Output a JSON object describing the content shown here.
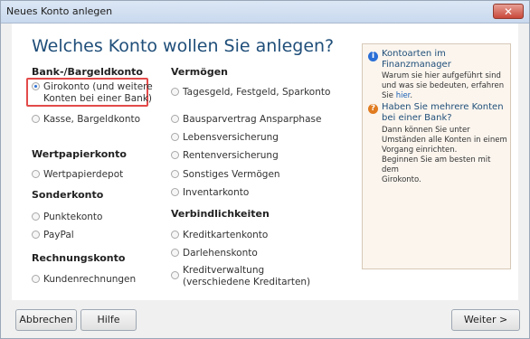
{
  "window": {
    "title": "Neues Konto anlegen",
    "close_symbol": "✕"
  },
  "heading": "Welches Konto wollen Sie anlegen?",
  "columns": {
    "bank_title": "Bank-/Bargeldkonto",
    "girokonto_line1": "Girokonto (und weitere",
    "girokonto_line2": "Konten bei einer Bank)",
    "kasse": "Kasse, Bargeldkonto",
    "wertpapier_title": "Wertpapierkonto",
    "wertpapierdepot": "Wertpapierdepot",
    "sonder_title": "Sonderkonto",
    "punktekonto": "Punktekonto",
    "paypal": "PayPal",
    "rechnung_title": "Rechnungskonto",
    "kundenrechnungen": "Kundenrechnungen",
    "vermoegen_title": "Vermögen",
    "tagesgeld": "Tagesgeld, Festgeld, Sparkonto",
    "bausparvertrag": "Bausparvertrag Ansparphase",
    "lebensversicherung": "Lebensversicherung",
    "rentenversicherung": "Rentenversicherung",
    "sonstiges": "Sonstiges Vermögen",
    "inventar": "Inventarkonto",
    "verbindlichkeiten_title": "Verbindlichkeiten",
    "kreditkarten": "Kreditkartenkonto",
    "darlehens": "Darlehenskonto",
    "kredit_line1": "Kreditverwaltung",
    "kredit_line2": "(verschiedene Kreditarten)"
  },
  "info": {
    "title1_line1": "Kontoarten im",
    "title1_line2": "Finanzmanager",
    "text1_line1": "Warum sie hier aufgeführt sind",
    "text1_line2": "und was sie bedeuten, erfahren",
    "text1_prefix": "Sie ",
    "text1_link": "hier",
    "text1_suffix": ".",
    "title2_line1": "Haben Sie mehrere Konten",
    "title2_line2": "bei einer Bank?",
    "text2_line1": "Dann können Sie unter",
    "text2_line2": "Umständen alle Konten in einem",
    "text2_line3": "Vorgang einrichten.",
    "text2_line4": "Beginnen Sie am besten mit dem",
    "text2_line5": "Girokonto."
  },
  "footer": {
    "cancel": "Abbrechen",
    "help": "Hilfe",
    "next": "Weiter >"
  },
  "colors": {
    "heading": "#1f4e79",
    "highlight": "#e34a4a",
    "info_bg": "#fbf5ee"
  }
}
